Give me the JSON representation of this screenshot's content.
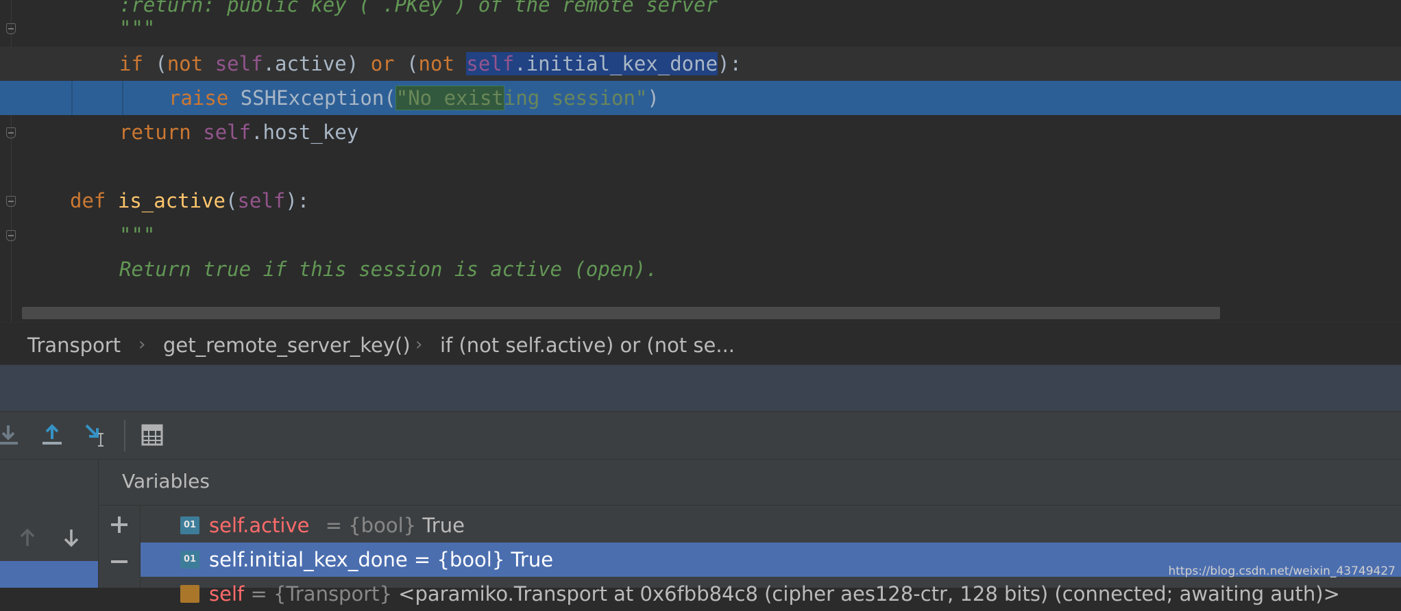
{
  "editor": {
    "lines": [
      {
        "id": "l0",
        "parts": [
          {
            "t": ":return: public key (`.PKey`) of the remote server",
            "c": "doc"
          }
        ]
      },
      {
        "id": "l1",
        "parts": [
          {
            "t": "\"\"\"",
            "c": "doc"
          }
        ]
      },
      {
        "id": "l2",
        "parts": [
          {
            "t": "if",
            "c": "kw"
          },
          {
            "t": " (",
            "c": ""
          },
          {
            "t": "not",
            "c": "kw"
          },
          {
            "t": " ",
            "c": ""
          },
          {
            "t": "self",
            "c": "self"
          },
          {
            "t": ".active) ",
            "c": ""
          },
          {
            "t": "or",
            "c": "kw"
          },
          {
            "t": " (",
            "c": ""
          },
          {
            "t": "not",
            "c": "kw"
          },
          {
            "t": " ",
            "c": ""
          },
          {
            "t": "self",
            "c": "self hl-word"
          },
          {
            "t": ".initial_kex_done",
            "c": "hl-word"
          },
          {
            "t": "):",
            "c": ""
          }
        ]
      },
      {
        "id": "l3",
        "parts": [
          {
            "t": "raise",
            "c": "kw"
          },
          {
            "t": " SSHException(",
            "c": ""
          },
          {
            "t": "\"No exist",
            "c": "str hl-match"
          },
          {
            "t": "ing session\"",
            "c": "str"
          },
          {
            "t": ")",
            "c": ""
          }
        ]
      },
      {
        "id": "l4",
        "parts": [
          {
            "t": "return",
            "c": "kw"
          },
          {
            "t": " ",
            "c": ""
          },
          {
            "t": "self",
            "c": "self"
          },
          {
            "t": ".host_key",
            "c": ""
          }
        ]
      },
      {
        "id": "l5",
        "parts": [
          {
            "t": "def",
            "c": "kw"
          },
          {
            "t": " ",
            "c": ""
          },
          {
            "t": "is_active",
            "c": "fn"
          },
          {
            "t": "(",
            "c": ""
          },
          {
            "t": "self",
            "c": "self"
          },
          {
            "t": "):",
            "c": ""
          }
        ]
      },
      {
        "id": "l6",
        "parts": [
          {
            "t": "\"\"\"",
            "c": "doc"
          }
        ]
      },
      {
        "id": "l7",
        "parts": [
          {
            "t": "Return true if this session is active (open).",
            "c": "doc"
          }
        ]
      }
    ]
  },
  "breadcrumb": {
    "items": [
      "Transport",
      "get_remote_server_key()",
      "if (not self.active) or (not se..."
    ]
  },
  "toolbar": {
    "icons": [
      "step-into-icon",
      "step-out-icon",
      "run-to-cursor-icon",
      "evaluate-expression-icon"
    ]
  },
  "variables": {
    "title": "Variables",
    "rows": [
      {
        "badge": "01",
        "name": "self.active",
        "type": "{bool}",
        "value": "True",
        "selected": false
      },
      {
        "badge": "01",
        "name": "self.initial_kex_done",
        "type": "{bool}",
        "value": "True",
        "selected": true
      },
      {
        "badge": "",
        "name": "self",
        "type": "{Transport}",
        "value": "<paramiko.Transport at 0x6fbb84c8 (cipher aes128-ctr, 128 bits) (connected; awaiting auth)>",
        "selected": false
      }
    ]
  },
  "watermark": "https://blog.csdn.net/weixin_43749427",
  "colors": {
    "editor_bg": "#2b2b2b",
    "keyword": "#cc7832",
    "self": "#94558d",
    "docstring": "#629755",
    "selection": "#2d5f97",
    "panel_bg": "#3c3f41",
    "selected_row": "#4b6eaf"
  }
}
